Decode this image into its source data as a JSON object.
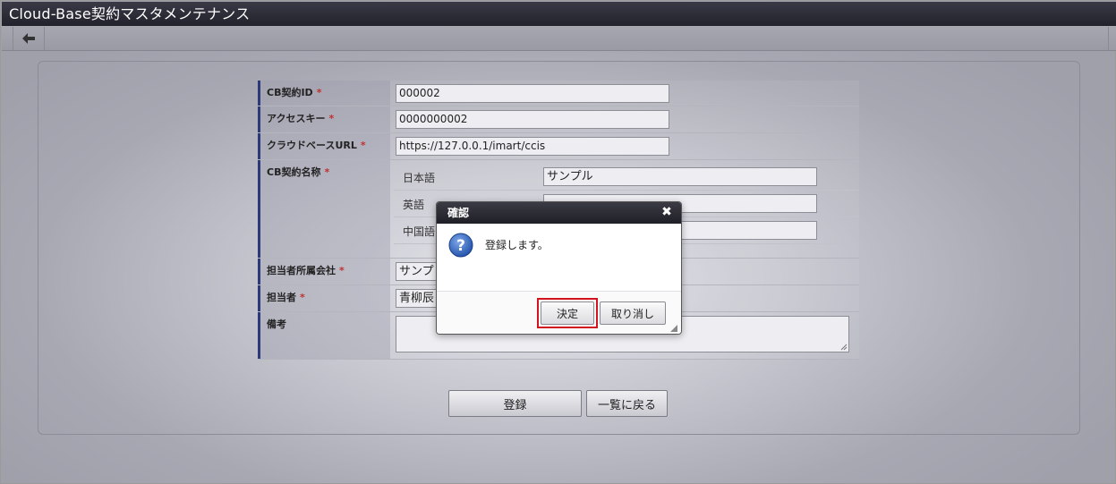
{
  "window": {
    "title": "Cloud-Base契約マスタメンテナンス"
  },
  "toolbar": {
    "back_icon": "arrow-left-icon"
  },
  "form": {
    "required_mark": "*",
    "contract_id": {
      "label": "CB契約ID",
      "value": "000002"
    },
    "access_key": {
      "label": "アクセスキー",
      "value": "0000000002"
    },
    "cloud_base_url": {
      "label": "クラウドベースURL",
      "value": "https://127.0.0.1/imart/ccis"
    },
    "contract_name": {
      "label": "CB契約名称",
      "locales": [
        {
          "label": "日本語",
          "value": "サンプル"
        },
        {
          "label": "英語",
          "value": ""
        },
        {
          "label": "中国語",
          "value": ""
        }
      ]
    },
    "company": {
      "label": "担当者所属会社",
      "value": "サンプ"
    },
    "person": {
      "label": "担当者",
      "value": "青柳辰"
    },
    "remarks": {
      "label": "備考",
      "value": ""
    }
  },
  "actions": {
    "register": "登録",
    "back_to_list": "一覧に戻る"
  },
  "dialog": {
    "title": "確認",
    "message": "登録します。",
    "ok": "決定",
    "cancel": "取り消し",
    "icon": "question-icon"
  },
  "colors": {
    "titlebar": "#2b2b36",
    "label_accent": "#2d3a7a",
    "required": "#c03030",
    "highlight": "#d2141e",
    "dialog_icon": "#2f5fb8"
  }
}
